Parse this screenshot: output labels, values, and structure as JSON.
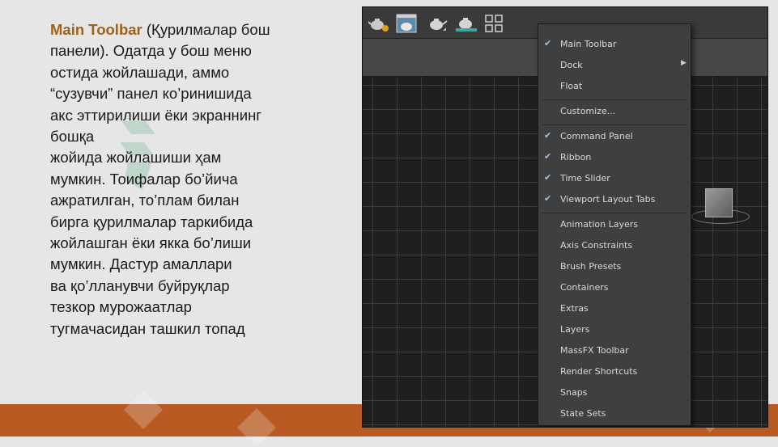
{
  "text": {
    "term": "Main Toolbar",
    "line1_rest": " (Қурилмалар бош",
    "lines": [
      "панели). Одатда у бош меню",
      "остида жойлашади, аммо",
      "“сузувчи” панел ко’ринишида",
      "акс эттирилиши ёки экраннинг",
      "бошқа",
      "жойида жойлашиши ҳам",
      "мумкин. Тоифалар бо’йича",
      "ажратилган, то’плам билан",
      "бирга қурилмалар таркибида",
      "жойлашган ёки якка бо’лиши",
      "мумкин. Дастур амаллари",
      "ва қо’лланувчи буйруқлар",
      "тезкор мурожаатлар",
      "тугмачасидан ташкил топад"
    ]
  },
  "colors": {
    "term": "#a0611a",
    "bottom_band": "#b85a22",
    "menu_bg": "#3f3f3f",
    "check": "#9fc3e8"
  },
  "toolbar_icons": [
    "teapot-gear-icon",
    "render-frame-icon",
    "teapot-render-icon",
    "teapot-active-render-icon",
    "layout-grid-icon"
  ],
  "menu": {
    "items": [
      {
        "label": "Main Toolbar",
        "checked": true
      },
      {
        "label": "Dock",
        "submenu": true
      },
      {
        "label": "Float"
      },
      {
        "label": "Customize...",
        "separator_before": true
      },
      {
        "label": "Command Panel",
        "checked": true,
        "separator_before": true
      },
      {
        "label": "Ribbon",
        "checked": true
      },
      {
        "label": "Time Slider",
        "checked": true
      },
      {
        "label": "Viewport Layout Tabs",
        "checked": true
      },
      {
        "label": "Animation Layers",
        "separator_before": true
      },
      {
        "label": "Axis Constraints"
      },
      {
        "label": "Brush Presets"
      },
      {
        "label": "Containers"
      },
      {
        "label": "Extras"
      },
      {
        "label": "Layers"
      },
      {
        "label": "MassFX Toolbar"
      },
      {
        "label": "Render Shortcuts"
      },
      {
        "label": "Snaps"
      },
      {
        "label": "State Sets"
      }
    ]
  }
}
